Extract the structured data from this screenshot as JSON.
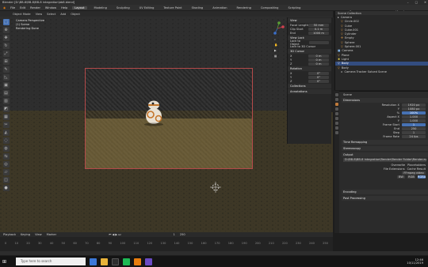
{
  "window": {
    "title": "Blender [D:\\BB-8\\BB-8\\BB-8 integration\\bb8.blend]"
  },
  "menubar": {
    "items": [
      "File",
      "Edit",
      "Render",
      "Window",
      "Help"
    ],
    "workspaces": [
      "Layout",
      "Modeling",
      "Sculpting",
      "UV Editing",
      "Texture Paint",
      "Shading",
      "Animation",
      "Rendering",
      "Compositing",
      "Scripting"
    ],
    "scene": "Scene",
    "view_layer": "View Layer"
  },
  "viewport": {
    "header_items": [
      "Object Mode",
      "View",
      "Select",
      "Add",
      "Object"
    ],
    "camera_info": [
      "Camera Perspective",
      "(1) Scene",
      "Rendering Done"
    ]
  },
  "npanel": {
    "sections": [
      {
        "title": "View",
        "rows": [
          [
            "Focal Length",
            "50 mm"
          ],
          [
            "Clip Start",
            "0.1 m"
          ],
          [
            "End",
            "1000 m"
          ]
        ]
      },
      {
        "title": "View Lock",
        "rows": [
          [
            "Lock to Object",
            ""
          ],
          [
            "Lock to 3D Cursor",
            ""
          ]
        ]
      },
      {
        "title": "3D Cursor",
        "rows": [
          [
            "X",
            "0 m"
          ],
          [
            "Y",
            "0 m"
          ],
          [
            "Z",
            "0 m"
          ]
        ]
      },
      {
        "title": "Rotation",
        "rows": [
          [
            "X",
            "0°"
          ],
          [
            "Y",
            "0°"
          ],
          [
            "Z",
            "0°"
          ]
        ]
      }
    ],
    "collections": "Collections",
    "annotations": "Annotations"
  },
  "outliner": {
    "title": "Scene Collection",
    "rows": [
      {
        "label": "Scene Collection",
        "selected": false
      },
      {
        "label": "Camera",
        "selected": false
      },
      {
        "label": "Circle.002",
        "selected": false
      },
      {
        "label": "Cube",
        "selected": false
      },
      {
        "label": "Cube.001",
        "selected": false
      },
      {
        "label": "Cylinder",
        "selected": false
      },
      {
        "label": "Empty",
        "selected": false
      },
      {
        "label": "Sphere",
        "selected": false
      },
      {
        "label": "Sphere.001",
        "selected": false
      },
      {
        "label": "Camera",
        "selected": false
      },
      {
        "label": "Plane",
        "selected": false
      },
      {
        "label": "Light",
        "selected": false
      },
      {
        "label": "Body",
        "selected": true
      },
      {
        "label": "Body",
        "selected": false
      },
      {
        "label": "Camera Tracker Solved Scene",
        "selected": false
      }
    ]
  },
  "properties": {
    "scene_label": "Scene",
    "sections": [
      {
        "title": "Dimensions",
        "rows": [
          [
            "Resolution X",
            "1920 px"
          ],
          [
            "Y",
            "1080 px"
          ],
          [
            "%",
            "100%"
          ],
          [
            "Aspect X",
            "1.000"
          ],
          [
            "Y",
            "1.000"
          ]
        ]
      },
      {
        "title": "Frame Range",
        "rows": [
          [
            "Frame Start",
            "1"
          ],
          [
            "End",
            "250"
          ],
          [
            "Step",
            "1"
          ]
        ]
      },
      {
        "title": "Frame Rate",
        "rows": [
          [
            "",
            "24 fps"
          ]
        ]
      },
      {
        "title": "Time Remapping",
        "rows": []
      },
      {
        "title": "Stereoscopy",
        "rows": []
      },
      {
        "title": "Output",
        "rows": [
          [
            "",
            "D:\\BB-8\\BB-8 integration\\Render\\Render Folder\\Render.avi"
          ]
        ]
      }
    ],
    "output_options": [
      "Overwrite",
      "Placeholders",
      "File Extensions",
      "Cache Result"
    ],
    "file_format": "FFmpeg video",
    "color_modes": [
      "BW",
      "RGB",
      "RGBA"
    ],
    "encoding": "Encoding",
    "postprocessing": "Post Processing"
  },
  "timeline": {
    "header": [
      "Playback",
      "Keying",
      "View",
      "Marker"
    ],
    "ticks": [
      "0",
      "10",
      "20",
      "30",
      "40",
      "50",
      "60",
      "70",
      "80",
      "90",
      "100",
      "110",
      "120",
      "130",
      "140",
      "150",
      "160",
      "170",
      "180",
      "190",
      "200",
      "210",
      "220",
      "230",
      "240",
      "250"
    ],
    "start": "1",
    "end": "250"
  },
  "taskbar": {
    "search_placeholder": "Type here to search",
    "time": "12:46",
    "date": "10/11/2019"
  },
  "colors": {
    "accent": "#4772b3",
    "selected": "#334d80",
    "camera_frame": "#b44a4a"
  }
}
